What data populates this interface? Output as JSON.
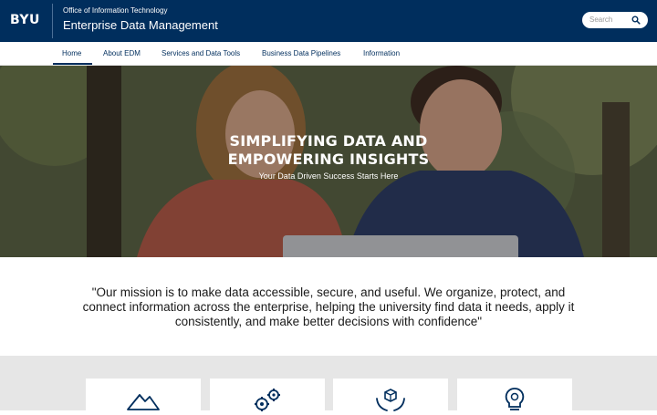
{
  "header": {
    "logo": "BYU",
    "subtitle": "Office of Information Technology",
    "title": "Enterprise Data Management",
    "search_placeholder": "Search"
  },
  "nav": {
    "items": [
      {
        "label": "Home"
      },
      {
        "label": "About EDM"
      },
      {
        "label": "Services and Data Tools"
      },
      {
        "label": "Business Data Pipelines"
      },
      {
        "label": "Information"
      }
    ],
    "active": "Home"
  },
  "hero": {
    "title_line1": "SIMPLIFYING DATA AND",
    "title_line2": "EMPOWERING INSIGHTS",
    "subtitle": "Your Data Driven Success Starts Here"
  },
  "mission": {
    "text": "\"Our mission is to make data accessible, secure, and useful. We organize, protect, and connect information across the enterprise, helping the university find data it needs, apply it consistently, and make better decisions with confidence\""
  },
  "cards": [
    {
      "icon": "mountain-icon"
    },
    {
      "icon": "gears-icon"
    },
    {
      "icon": "hands-cube-icon"
    },
    {
      "icon": "lightbulb-gear-icon"
    }
  ],
  "colors": {
    "brand_navy": "#002e5d",
    "card_section_bg": "#e6e6e6"
  }
}
